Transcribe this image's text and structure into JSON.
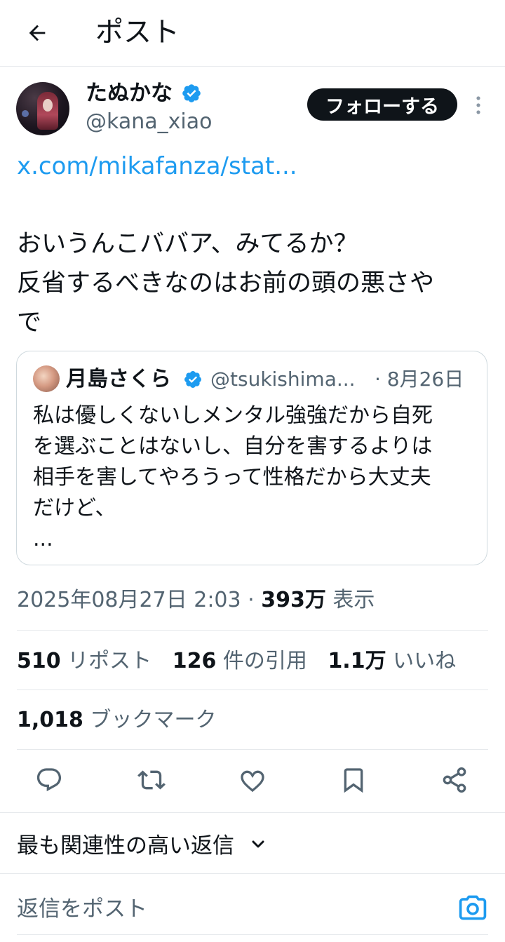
{
  "header": {
    "title": "ポスト",
    "back_icon": "arrow-left-icon"
  },
  "author": {
    "display_name": "たぬかな",
    "handle": "@kana_xiao",
    "verified": true,
    "follow_label": "フォローする",
    "more_icon": "more-vertical-icon"
  },
  "post": {
    "link": "x.com/mikafanza/stat...",
    "text": "おいうんこババア、みてるか？\n反省するべきなのはお前の頭の悪さや\nで"
  },
  "quote": {
    "display_name": "月島さくら",
    "handle": "@tsukishima...",
    "date": "· 8月26日",
    "text": "私は優しくないしメンタル強強だから自死\nを選ぶことはないし、自分を害するよりは\n相手を害してやろうって性格だから大丈夫\nだけど、",
    "ellipsis": "..."
  },
  "meta": {
    "datetime": "2025年08月27日 2:03 · ",
    "views_count": "393万",
    "views_label": " 表示"
  },
  "stats": {
    "reposts_count": "510",
    "reposts_label": "リポスト",
    "quotes_count": "126",
    "quotes_label": "件の引用",
    "likes_count": "1.1万",
    "likes_label": "いいね",
    "bookmarks_count": "1,018",
    "bookmarks_label": "ブックマーク"
  },
  "actions": [
    "reply-icon",
    "repost-icon",
    "like-icon",
    "bookmark-icon",
    "share-icon"
  ],
  "sort": {
    "label": "最も関連性の高い返信",
    "icon": "chevron-down-icon"
  },
  "reply": {
    "placeholder": "返信をポスト",
    "camera_icon": "camera-icon"
  },
  "colors": {
    "accent": "#1d9bf0",
    "text": "#0f1419",
    "secondary": "#536471",
    "border": "#cfd9de"
  }
}
